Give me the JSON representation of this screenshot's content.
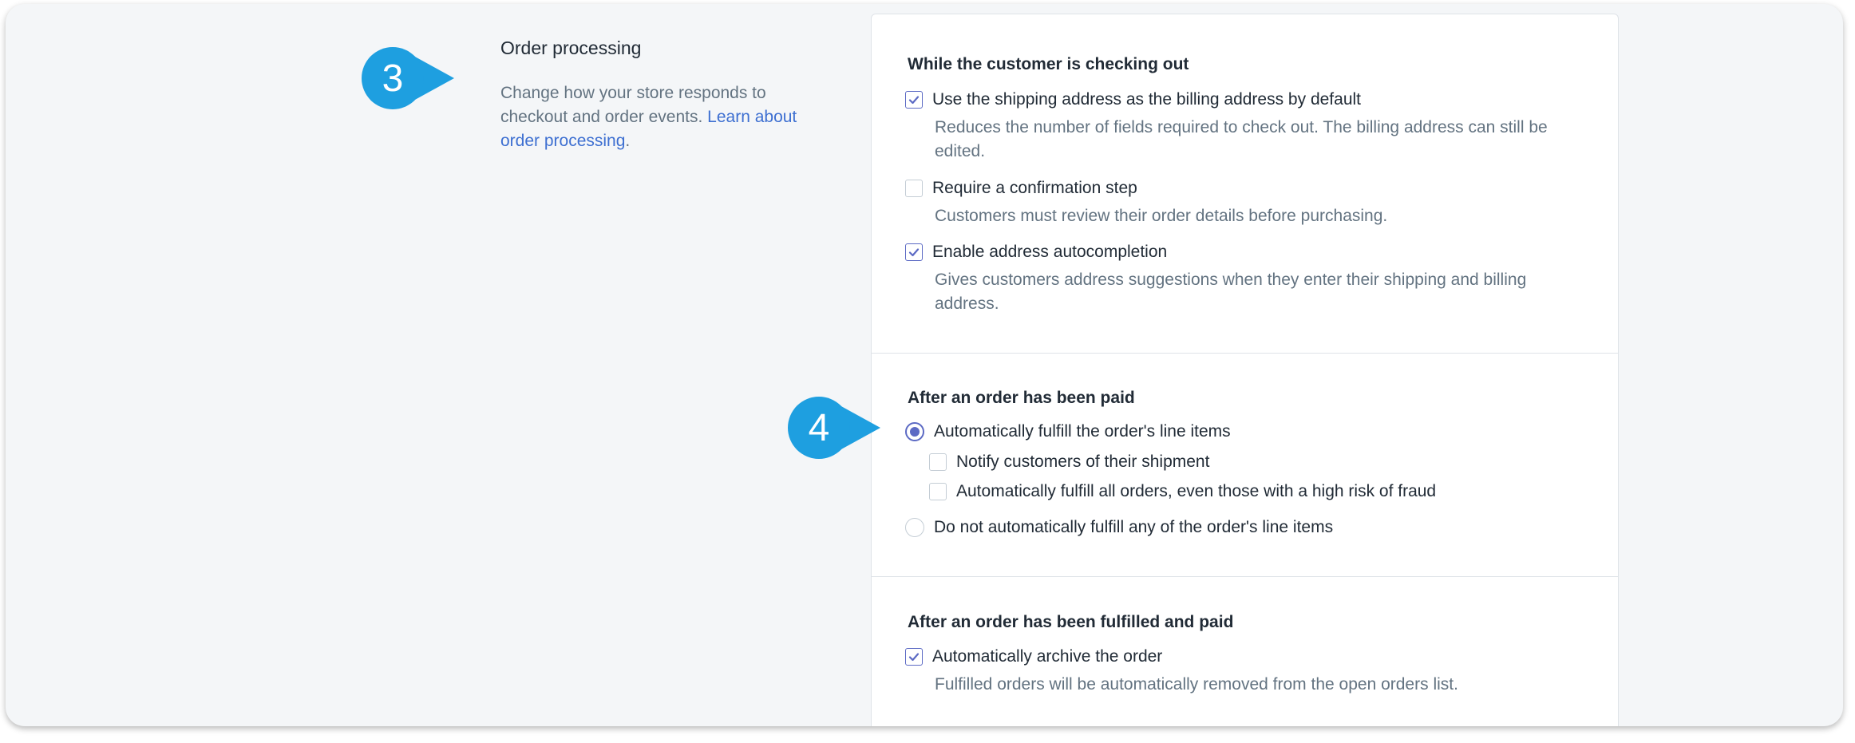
{
  "markers": {
    "step3": "3",
    "step4": "4"
  },
  "aside": {
    "title": "Order processing",
    "description": "Change how your store responds to checkout and order events.",
    "link": "Learn about order processing",
    "period": "."
  },
  "checkout": {
    "heading": "While the customer is checking out",
    "options": [
      {
        "label": "Use the shipping address as the billing address by default",
        "checked": true,
        "help": "Reduces the number of fields required to check out. The billing address can still be edited."
      },
      {
        "label": "Require a confirmation step",
        "checked": false,
        "help": "Customers must review their order details before purchasing."
      },
      {
        "label": "Enable address autocompletion",
        "checked": true,
        "help": "Gives customers address suggestions when they enter their shipping and billing address."
      }
    ]
  },
  "paid": {
    "heading": "After an order has been paid",
    "auto_fulfill": {
      "label": "Automatically fulfill the order's line items",
      "selected": true
    },
    "sub_options": [
      {
        "label": "Notify customers of their shipment",
        "checked": false
      },
      {
        "label": "Automatically fulfill all orders, even those with a high risk of fraud",
        "checked": false
      }
    ],
    "no_fulfill": {
      "label": "Do not automatically fulfill any of the order's line items",
      "selected": false
    }
  },
  "fulfilled": {
    "heading": "After an order has been fulfilled and paid",
    "options": [
      {
        "label": "Automatically archive the order",
        "checked": true,
        "help": "Fulfilled orders will be automatically removed from the open orders list."
      }
    ]
  },
  "colors": {
    "accent": "#5c6ac4",
    "marker": "#1e9fe0",
    "link": "#3d6fd1"
  },
  "icons": {
    "check": "checkmark-icon"
  }
}
